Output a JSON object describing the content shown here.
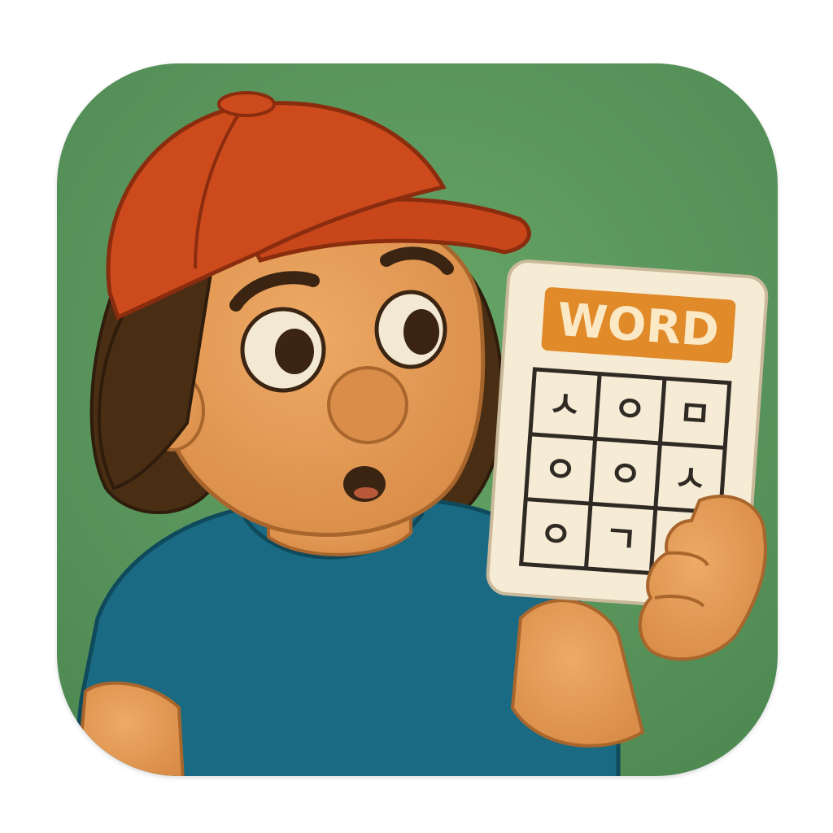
{
  "app_icon": {
    "background_color": "#5e9a5e",
    "character": {
      "cap_color": "#cc4a1c",
      "hair_color": "#4a2e14",
      "skin_color": "#e29a55",
      "shirt_color": "#196a82"
    },
    "card": {
      "title": "WORD",
      "title_bg_color": "#e08a2a",
      "title_text_color": "#fbe9c6",
      "card_color": "#f6ecd6",
      "grid_line_color": "#2f2a24",
      "grid_rows": [
        [
          "ㅅ",
          "ㅇ",
          "ㅁ"
        ],
        [
          "ㅇ",
          "ㅇ",
          "ㅅ"
        ],
        [
          "ㅇ",
          "ㄱ",
          ""
        ]
      ]
    }
  }
}
